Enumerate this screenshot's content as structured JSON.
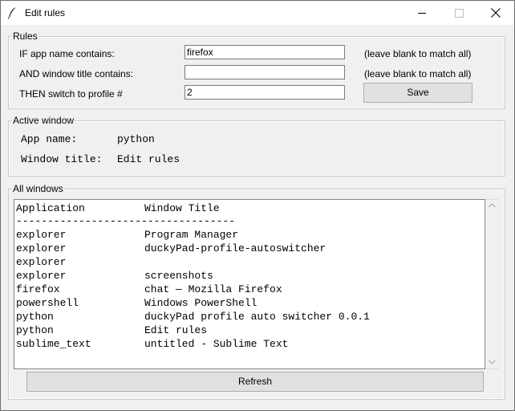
{
  "window": {
    "title": "Edit rules",
    "icon": "feather-icon"
  },
  "rules": {
    "legend": "Rules",
    "app_label": "IF app name contains:",
    "app_value": "firefox",
    "app_hint": "(leave blank to match all)",
    "title_label": "AND window title contains:",
    "title_value": "",
    "title_hint": "(leave blank to match all)",
    "profile_label": "THEN switch to profile #",
    "profile_value": "2",
    "save_label": "Save"
  },
  "active": {
    "legend": "Active window",
    "app_label": "App name:",
    "app_value": "python",
    "title_label": "Window title:",
    "title_value": "Edit rules"
  },
  "all_windows": {
    "legend": "All windows",
    "header": {
      "app": "Application",
      "title": "Window Title"
    },
    "separator": "-----------------------------------",
    "rows": [
      {
        "app": "explorer",
        "title": "Program Manager"
      },
      {
        "app": "explorer",
        "title": "duckyPad-profile-autoswitcher"
      },
      {
        "app": "explorer",
        "title": ""
      },
      {
        "app": "explorer",
        "title": "screenshots"
      },
      {
        "app": "firefox",
        "title": "chat — Mozilla Firefox"
      },
      {
        "app": "powershell",
        "title": "Windows PowerShell"
      },
      {
        "app": "python",
        "title": "duckyPad profile auto switcher 0.0.1"
      },
      {
        "app": "python",
        "title": "Edit rules"
      },
      {
        "app": "sublime_text",
        "title": "untitled - Sublime Text"
      }
    ],
    "refresh_label": "Refresh"
  }
}
